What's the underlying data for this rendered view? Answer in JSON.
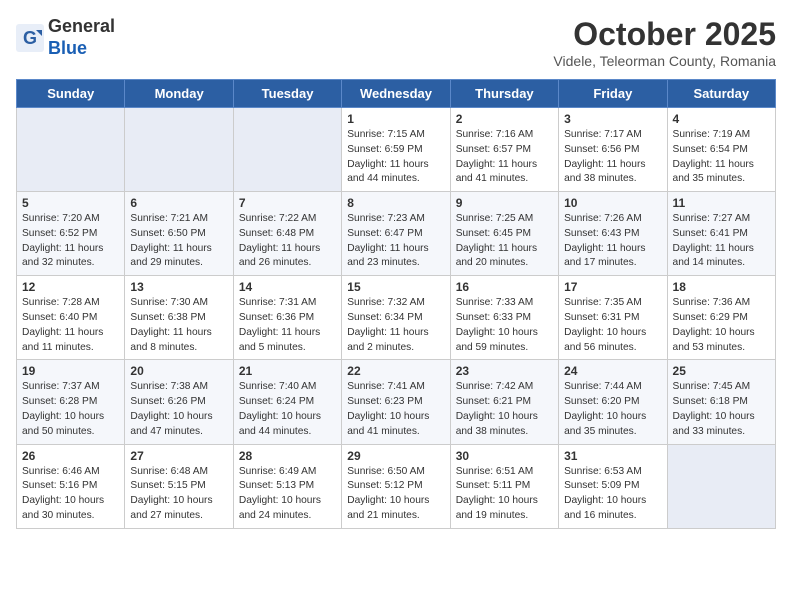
{
  "header": {
    "logo_line1": "General",
    "logo_line2": "Blue",
    "month": "October 2025",
    "location": "Videle, Teleorman County, Romania"
  },
  "weekdays": [
    "Sunday",
    "Monday",
    "Tuesday",
    "Wednesday",
    "Thursday",
    "Friday",
    "Saturday"
  ],
  "weeks": [
    [
      {
        "day": "",
        "info": ""
      },
      {
        "day": "",
        "info": ""
      },
      {
        "day": "",
        "info": ""
      },
      {
        "day": "1",
        "info": "Sunrise: 7:15 AM\nSunset: 6:59 PM\nDaylight: 11 hours and 44 minutes."
      },
      {
        "day": "2",
        "info": "Sunrise: 7:16 AM\nSunset: 6:57 PM\nDaylight: 11 hours and 41 minutes."
      },
      {
        "day": "3",
        "info": "Sunrise: 7:17 AM\nSunset: 6:56 PM\nDaylight: 11 hours and 38 minutes."
      },
      {
        "day": "4",
        "info": "Sunrise: 7:19 AM\nSunset: 6:54 PM\nDaylight: 11 hours and 35 minutes."
      }
    ],
    [
      {
        "day": "5",
        "info": "Sunrise: 7:20 AM\nSunset: 6:52 PM\nDaylight: 11 hours and 32 minutes."
      },
      {
        "day": "6",
        "info": "Sunrise: 7:21 AM\nSunset: 6:50 PM\nDaylight: 11 hours and 29 minutes."
      },
      {
        "day": "7",
        "info": "Sunrise: 7:22 AM\nSunset: 6:48 PM\nDaylight: 11 hours and 26 minutes."
      },
      {
        "day": "8",
        "info": "Sunrise: 7:23 AM\nSunset: 6:47 PM\nDaylight: 11 hours and 23 minutes."
      },
      {
        "day": "9",
        "info": "Sunrise: 7:25 AM\nSunset: 6:45 PM\nDaylight: 11 hours and 20 minutes."
      },
      {
        "day": "10",
        "info": "Sunrise: 7:26 AM\nSunset: 6:43 PM\nDaylight: 11 hours and 17 minutes."
      },
      {
        "day": "11",
        "info": "Sunrise: 7:27 AM\nSunset: 6:41 PM\nDaylight: 11 hours and 14 minutes."
      }
    ],
    [
      {
        "day": "12",
        "info": "Sunrise: 7:28 AM\nSunset: 6:40 PM\nDaylight: 11 hours and 11 minutes."
      },
      {
        "day": "13",
        "info": "Sunrise: 7:30 AM\nSunset: 6:38 PM\nDaylight: 11 hours and 8 minutes."
      },
      {
        "day": "14",
        "info": "Sunrise: 7:31 AM\nSunset: 6:36 PM\nDaylight: 11 hours and 5 minutes."
      },
      {
        "day": "15",
        "info": "Sunrise: 7:32 AM\nSunset: 6:34 PM\nDaylight: 11 hours and 2 minutes."
      },
      {
        "day": "16",
        "info": "Sunrise: 7:33 AM\nSunset: 6:33 PM\nDaylight: 10 hours and 59 minutes."
      },
      {
        "day": "17",
        "info": "Sunrise: 7:35 AM\nSunset: 6:31 PM\nDaylight: 10 hours and 56 minutes."
      },
      {
        "day": "18",
        "info": "Sunrise: 7:36 AM\nSunset: 6:29 PM\nDaylight: 10 hours and 53 minutes."
      }
    ],
    [
      {
        "day": "19",
        "info": "Sunrise: 7:37 AM\nSunset: 6:28 PM\nDaylight: 10 hours and 50 minutes."
      },
      {
        "day": "20",
        "info": "Sunrise: 7:38 AM\nSunset: 6:26 PM\nDaylight: 10 hours and 47 minutes."
      },
      {
        "day": "21",
        "info": "Sunrise: 7:40 AM\nSunset: 6:24 PM\nDaylight: 10 hours and 44 minutes."
      },
      {
        "day": "22",
        "info": "Sunrise: 7:41 AM\nSunset: 6:23 PM\nDaylight: 10 hours and 41 minutes."
      },
      {
        "day": "23",
        "info": "Sunrise: 7:42 AM\nSunset: 6:21 PM\nDaylight: 10 hours and 38 minutes."
      },
      {
        "day": "24",
        "info": "Sunrise: 7:44 AM\nSunset: 6:20 PM\nDaylight: 10 hours and 35 minutes."
      },
      {
        "day": "25",
        "info": "Sunrise: 7:45 AM\nSunset: 6:18 PM\nDaylight: 10 hours and 33 minutes."
      }
    ],
    [
      {
        "day": "26",
        "info": "Sunrise: 6:46 AM\nSunset: 5:16 PM\nDaylight: 10 hours and 30 minutes."
      },
      {
        "day": "27",
        "info": "Sunrise: 6:48 AM\nSunset: 5:15 PM\nDaylight: 10 hours and 27 minutes."
      },
      {
        "day": "28",
        "info": "Sunrise: 6:49 AM\nSunset: 5:13 PM\nDaylight: 10 hours and 24 minutes."
      },
      {
        "day": "29",
        "info": "Sunrise: 6:50 AM\nSunset: 5:12 PM\nDaylight: 10 hours and 21 minutes."
      },
      {
        "day": "30",
        "info": "Sunrise: 6:51 AM\nSunset: 5:11 PM\nDaylight: 10 hours and 19 minutes."
      },
      {
        "day": "31",
        "info": "Sunrise: 6:53 AM\nSunset: 5:09 PM\nDaylight: 10 hours and 16 minutes."
      },
      {
        "day": "",
        "info": ""
      }
    ]
  ]
}
